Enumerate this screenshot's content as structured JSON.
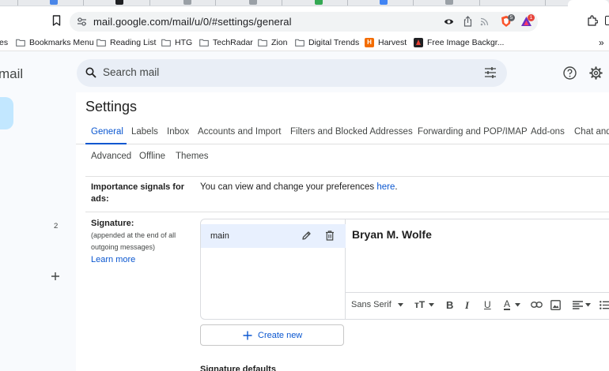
{
  "browser": {
    "url": "mail.google.com/mail/u/0/#settings/general",
    "brave_badge": "5",
    "alert_badge": "1"
  },
  "bookmarks": [
    {
      "label": "es"
    },
    {
      "label": "Bookmarks Menu"
    },
    {
      "label": "Reading List"
    },
    {
      "label": "HTG"
    },
    {
      "label": "TechRadar"
    },
    {
      "label": "Zion"
    },
    {
      "label": "Digital Trends"
    },
    {
      "label": "Harvest"
    },
    {
      "label": "Free Image Backgr..."
    }
  ],
  "gmail": {
    "brand": "mail",
    "search_placeholder": "Search mail",
    "left_count": "2"
  },
  "settings": {
    "title": "Settings",
    "tabs": [
      {
        "label": "General"
      },
      {
        "label": "Labels"
      },
      {
        "label": "Inbox"
      },
      {
        "label": "Accounts and Import"
      },
      {
        "label": "Filters and Blocked Addresses"
      },
      {
        "label": "Forwarding and POP/IMAP"
      },
      {
        "label": "Add-ons"
      },
      {
        "label": "Chat and Meet"
      }
    ],
    "tabs_row2": [
      {
        "label": "Advanced"
      },
      {
        "label": "Offline"
      },
      {
        "label": "Themes"
      }
    ],
    "importance": {
      "label_line1": "Importance signals for",
      "label_line2": "ads:",
      "text": "You can view and change your preferences ",
      "link": "here",
      "period": "."
    },
    "signature": {
      "label": "Signature:",
      "note_line1": "(appended at the end of all",
      "note_line2": "outgoing messages)",
      "learn_more": "Learn more",
      "items": [
        {
          "name": "main"
        }
      ],
      "content": "Bryan M. Wolfe",
      "font": "Sans Serif",
      "create_new": "Create new",
      "defaults_label": "Signature defaults"
    }
  },
  "colors": {
    "accent": "#0b57d0",
    "selected_bg": "#e8f0fe",
    "search_bg": "#e9eef6",
    "compose_bg": "#c2e7ff"
  }
}
